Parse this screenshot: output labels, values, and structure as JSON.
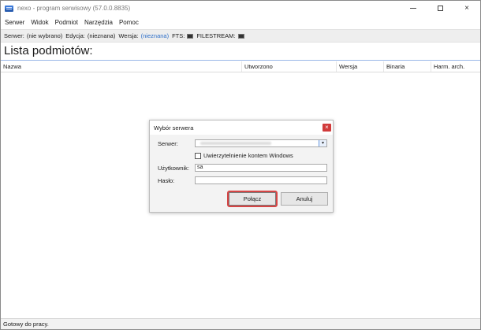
{
  "window": {
    "title": "nexo - program serwisowy (57.0.0.8835)",
    "controls": {
      "minimize": "minimize-icon",
      "maximize": "maximize-icon",
      "close": "×"
    }
  },
  "menu": {
    "items": [
      "Serwer",
      "Widok",
      "Podmiot",
      "Narzędzia",
      "Pomoc"
    ]
  },
  "info": {
    "server_label": "Serwer:",
    "server_value": "(nie wybrano)",
    "edition_label": "Edycja:",
    "edition_value": "(nieznana)",
    "version_label": "Wersja:",
    "version_value": "(nieznana)",
    "fts_label": "FTS:",
    "filestream_label": "FILESTREAM:"
  },
  "page": {
    "title": "Lista podmiotów:"
  },
  "table": {
    "columns": [
      "Nazwa",
      "Utworzono",
      "Wersja",
      "Binaria",
      "Harm. arch."
    ],
    "rows": []
  },
  "status": {
    "text": "Gotowy do pracy."
  },
  "dialog": {
    "title": "Wybór serwera",
    "close_label": "×",
    "server_label": "Serwer:",
    "server_value": "",
    "windows_auth_label": "Uwierzytelnienie kontem Windows",
    "windows_auth_checked": false,
    "user_label": "Użytkownik:",
    "user_value": "sa",
    "password_label": "Hasło:",
    "password_value": "",
    "connect_label": "Połącz",
    "cancel_label": "Anuluj"
  },
  "colors": {
    "accent_link": "#2d6fc9",
    "highlight_outline": "#d64545",
    "close_red": "#d13b3b",
    "title_underline": "#9ab8e8"
  },
  "icons": {
    "app": "app-logo-icon",
    "combo": "chevron-down-icon"
  }
}
